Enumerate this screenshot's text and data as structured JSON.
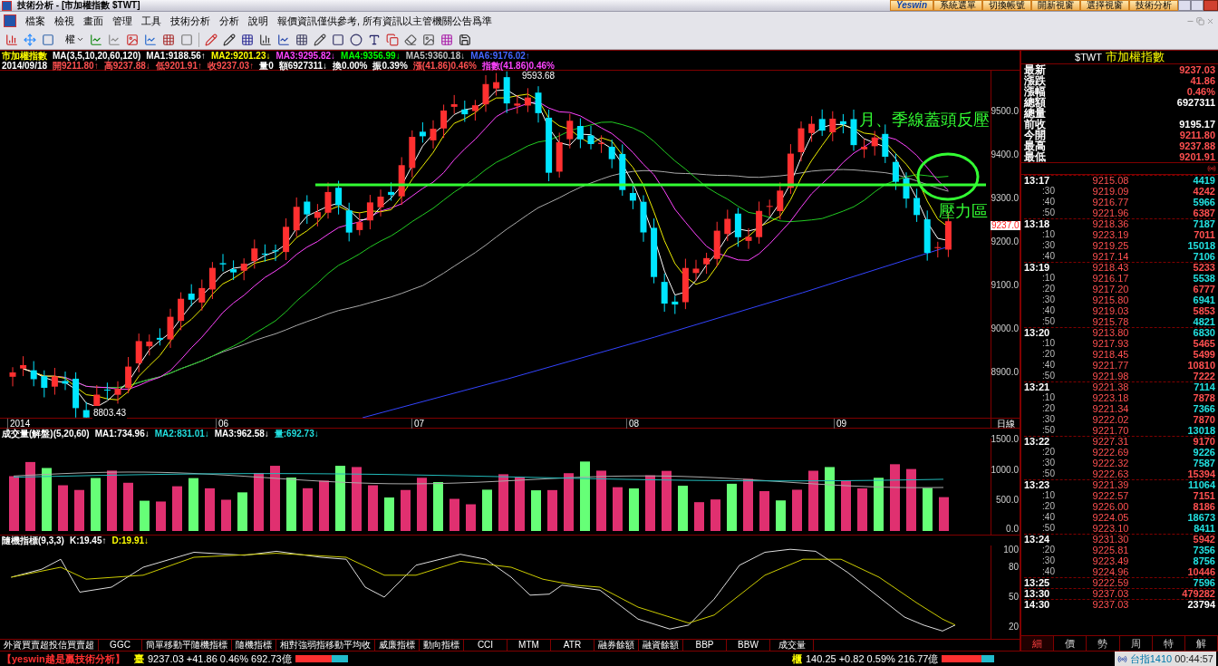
{
  "window": {
    "title": "技術分析 - [市加權指數 $TWT]"
  },
  "top_buttons": [
    {
      "label": "Yeswin",
      "kind": "logo"
    },
    {
      "label": "系統選單",
      "kind": "button"
    },
    {
      "label": "切換帳號",
      "kind": "button"
    },
    {
      "label": "開新視窗",
      "kind": "button"
    },
    {
      "label": "選擇視窗",
      "kind": "button"
    },
    {
      "label": "技術分析",
      "kind": "button"
    }
  ],
  "menu": [
    "檔案",
    "檢視",
    "畫面",
    "管理",
    "工具",
    "技術分析",
    "分析",
    "說明"
  ],
  "menu_notice": "報價資訊僅供參考, 所有資訊以主管機關公告爲準",
  "toolbar": {
    "rights_label": "權"
  },
  "chart": {
    "info_lines": [
      [
        {
          "text": "市加權指數",
          "color": "#ffff00"
        },
        {
          "text": "MA(3,5,10,20,60,120)",
          "color": "#ffffff"
        },
        {
          "text": "MA1:9188.56↑",
          "color": "#ffffff"
        },
        {
          "text": "MA2:9201.23↓",
          "color": "#ffff00"
        },
        {
          "text": "MA3:9295.82↓",
          "color": "#ff44ff"
        },
        {
          "text": "MA4:9356.99↓",
          "color": "#00ff00"
        },
        {
          "text": "MA5:9360.18↓",
          "color": "#c0c0c0"
        },
        {
          "text": "MA6:9176.02↑",
          "color": "#4466ff"
        }
      ],
      [
        {
          "text": "2014/09/18",
          "color": "#ffffff"
        },
        {
          "text": "開9211.80↑",
          "color": "#ff5050"
        },
        {
          "text": "高9237.88↓",
          "color": "#ff5050"
        },
        {
          "text": "低9201.91↑",
          "color": "#ff5050"
        },
        {
          "text": "收9237.03↑",
          "color": "#ff5050"
        },
        {
          "text": "量0",
          "color": "#ffffff"
        },
        {
          "text": "額6927311↓",
          "color": "#ffffff"
        },
        {
          "text": "換0.00%",
          "color": "#ffffff"
        },
        {
          "text": "振0.39%",
          "color": "#ffffff"
        },
        {
          "text": "漲(41.86)0.46%",
          "color": "#ff5050"
        },
        {
          "text": "指數(41.86)0.46%",
          "color": "#ff44ff"
        }
      ]
    ],
    "price_axis": [
      "9500.0",
      "9400.0",
      "9300.0",
      "9200.0",
      "9100.0",
      "9000.0",
      "8900.0"
    ],
    "price_marker": "9237.0",
    "high_label": "9593.68",
    "low_label": "8803.43",
    "annotations": [
      "月、季線蓋頭反壓",
      "壓力區"
    ],
    "date_axis": [
      "2014",
      "06",
      "07",
      "08",
      "09"
    ],
    "period": "日線",
    "volume": {
      "info": [
        {
          "text": "成交量(解盤)(5,20,60)",
          "color": "#ffffff"
        },
        {
          "text": "MA1:734.96↓",
          "color": "#ffffff"
        },
        {
          "text": "MA2:831.01↓",
          "color": "#22dddd"
        },
        {
          "text": "MA3:962.58↓",
          "color": "#ffffff"
        },
        {
          "text": "量:692.73↓",
          "color": "#22dddd"
        }
      ],
      "axis": [
        "1500.0",
        "1000.0",
        "500.0",
        "0.0"
      ]
    },
    "kd": {
      "info": [
        {
          "text": "隨機指標(9,3,3)",
          "color": "#ffffff"
        },
        {
          "text": "K:19.45↑",
          "color": "#ffffff"
        },
        {
          "text": "D:19.91↓",
          "color": "#ffff00"
        }
      ],
      "axis": [
        "100",
        "80",
        "50",
        "20"
      ]
    },
    "indicator_tabs": [
      "外資買賣超投信買賣超",
      "GGC",
      "簡單移動平隨機指標",
      "隨機指標",
      "相對強弱指移動平均收",
      "威廉指標",
      "動向指標",
      "CCI",
      "MTM",
      "ATR",
      "融券餘額",
      "融資餘額",
      "BBP",
      "BBW",
      "成交量"
    ]
  },
  "quote_panel": {
    "symbol": "$TWT",
    "name": "市加權指數",
    "rows": [
      {
        "label": "最新",
        "value": "9237.03",
        "color": "#ff5050"
      },
      {
        "label": "漲跌",
        "value": "41.86",
        "color": "#ff5050"
      },
      {
        "label": "漲幅",
        "value": "0.46%",
        "color": "#ff5050"
      },
      {
        "label": "總額",
        "value": "6927311",
        "color": "#ffffff"
      },
      {
        "label": "總量"
      },
      {
        "label": "前收",
        "value": "9195.17",
        "color": "#ffffff"
      },
      {
        "label": "今開",
        "value": "9211.80",
        "color": "#ff5050"
      },
      {
        "label": "最高",
        "value": "9237.88",
        "color": "#ff5050"
      },
      {
        "label": "最低",
        "value": "9201.91",
        "color": "#ff5050"
      }
    ],
    "ticks": [
      {
        "time": "13:17",
        "kind": "group",
        "price": "9215.08",
        "volume": "4419",
        "color": "#22e0e0"
      },
      {
        "time": ":30",
        "kind": "sub",
        "price": "9219.09",
        "volume": "4242",
        "color": "#ff5050"
      },
      {
        "time": ":40",
        "kind": "sub",
        "price": "9216.77",
        "volume": "5966",
        "color": "#22e0e0"
      },
      {
        "time": ":50",
        "kind": "sub",
        "price": "9221.96",
        "volume": "6387",
        "color": "#ff5050"
      },
      {
        "time": "13:18",
        "kind": "group",
        "price": "9218.36",
        "volume": "7187",
        "color": "#22e0e0"
      },
      {
        "time": ":10",
        "kind": "sub",
        "price": "9223.19",
        "volume": "7011",
        "color": "#ff5050"
      },
      {
        "time": ":30",
        "kind": "sub",
        "price": "9219.25",
        "volume": "15018",
        "color": "#22e0e0"
      },
      {
        "time": ":40",
        "kind": "sub",
        "price": "9217.14",
        "volume": "7106",
        "color": "#22e0e0"
      },
      {
        "time": "13:19",
        "kind": "group",
        "price": "9218.43",
        "volume": "5233",
        "color": "#ff5050"
      },
      {
        "time": ":10",
        "kind": "sub",
        "price": "9216.17",
        "volume": "5538",
        "color": "#22e0e0"
      },
      {
        "time": ":20",
        "kind": "sub",
        "price": "9217.20",
        "volume": "6777",
        "color": "#ff5050"
      },
      {
        "time": ":30",
        "kind": "sub",
        "price": "9215.80",
        "volume": "6941",
        "color": "#22e0e0"
      },
      {
        "time": ":40",
        "kind": "sub",
        "price": "9219.03",
        "volume": "5853",
        "color": "#ff5050"
      },
      {
        "time": ":50",
        "kind": "sub",
        "price": "9215.78",
        "volume": "4821",
        "color": "#22e0e0"
      },
      {
        "time": "13:20",
        "kind": "group",
        "price": "9213.80",
        "volume": "6830",
        "color": "#22e0e0"
      },
      {
        "time": ":10",
        "kind": "sub",
        "price": "9217.93",
        "volume": "5465",
        "color": "#ff5050"
      },
      {
        "time": ":20",
        "kind": "sub",
        "price": "9218.45",
        "volume": "5499",
        "color": "#ff5050"
      },
      {
        "time": ":40",
        "kind": "sub",
        "price": "9221.77",
        "volume": "10810",
        "color": "#ff5050"
      },
      {
        "time": ":50",
        "kind": "sub",
        "price": "9221.98",
        "volume": "7222",
        "color": "#ff5050"
      },
      {
        "time": "13:21",
        "kind": "group",
        "price": "9221.38",
        "volume": "7114",
        "color": "#22e0e0"
      },
      {
        "time": ":10",
        "kind": "sub",
        "price": "9223.18",
        "volume": "7878",
        "color": "#ff5050"
      },
      {
        "time": ":20",
        "kind": "sub",
        "price": "9221.34",
        "volume": "7366",
        "color": "#22e0e0"
      },
      {
        "time": ":30",
        "kind": "sub",
        "price": "9222.02",
        "volume": "7870",
        "color": "#ff5050"
      },
      {
        "time": ":50",
        "kind": "sub",
        "price": "9221.70",
        "volume": "13018",
        "color": "#22e0e0"
      },
      {
        "time": "13:22",
        "kind": "group",
        "price": "9227.31",
        "volume": "9170",
        "color": "#ff5050"
      },
      {
        "time": ":20",
        "kind": "sub",
        "price": "9222.69",
        "volume": "9226",
        "color": "#22e0e0"
      },
      {
        "time": ":30",
        "kind": "sub",
        "price": "9222.32",
        "volume": "7587",
        "color": "#22e0e0"
      },
      {
        "time": ":50",
        "kind": "sub",
        "price": "9222.63",
        "volume": "15394",
        "color": "#ff5050"
      },
      {
        "time": "13:23",
        "kind": "group",
        "price": "9221.39",
        "volume": "11064",
        "color": "#22e0e0"
      },
      {
        "time": ":10",
        "kind": "sub",
        "price": "9222.57",
        "volume": "7151",
        "color": "#ff5050"
      },
      {
        "time": ":20",
        "kind": "sub",
        "price": "9226.00",
        "volume": "8186",
        "color": "#ff5050"
      },
      {
        "time": ":40",
        "kind": "sub",
        "price": "9224.05",
        "volume": "18673",
        "color": "#22e0e0"
      },
      {
        "time": ":50",
        "kind": "sub",
        "price": "9223.10",
        "volume": "8411",
        "color": "#22e0e0"
      },
      {
        "time": "13:24",
        "kind": "group",
        "price": "9231.30",
        "volume": "5942",
        "color": "#ff5050"
      },
      {
        "time": ":20",
        "kind": "sub",
        "price": "9225.81",
        "volume": "7356",
        "color": "#22e0e0"
      },
      {
        "time": ":30",
        "kind": "sub",
        "price": "9223.49",
        "volume": "8756",
        "color": "#22e0e0"
      },
      {
        "time": ":40",
        "kind": "sub",
        "price": "9224.96",
        "volume": "10446",
        "color": "#ff5050"
      },
      {
        "time": "13:25",
        "kind": "group",
        "price": "9222.59",
        "volume": "7596",
        "color": "#22e0e0"
      },
      {
        "time": "13:30",
        "kind": "group",
        "price": "9237.03",
        "volume": "479282",
        "color": "#ff5050"
      },
      {
        "time": "14:30",
        "kind": "group",
        "price": "9237.03",
        "volume": "23794",
        "color": "#ffffff"
      }
    ],
    "tabs": [
      {
        "label": "細",
        "selected": true
      },
      {
        "label": "價",
        "selected": false
      },
      {
        "label": "勢",
        "selected": false
      },
      {
        "label": "周",
        "selected": false
      },
      {
        "label": "特",
        "selected": false
      },
      {
        "label": "解",
        "selected": false
      }
    ]
  },
  "status_bar": {
    "brand": "【yeswin越是贏技術分析】",
    "markets": [
      {
        "market": "臺",
        "quote": "9237.03 +41.86 0.46% 692.73億",
        "level": 0.7
      },
      {
        "market": "櫃",
        "quote": "140.25 +0.82 0.59% 216.77億",
        "level": 0.75
      }
    ],
    "futures": "台指1410",
    "clock": "00:44:57"
  }
}
